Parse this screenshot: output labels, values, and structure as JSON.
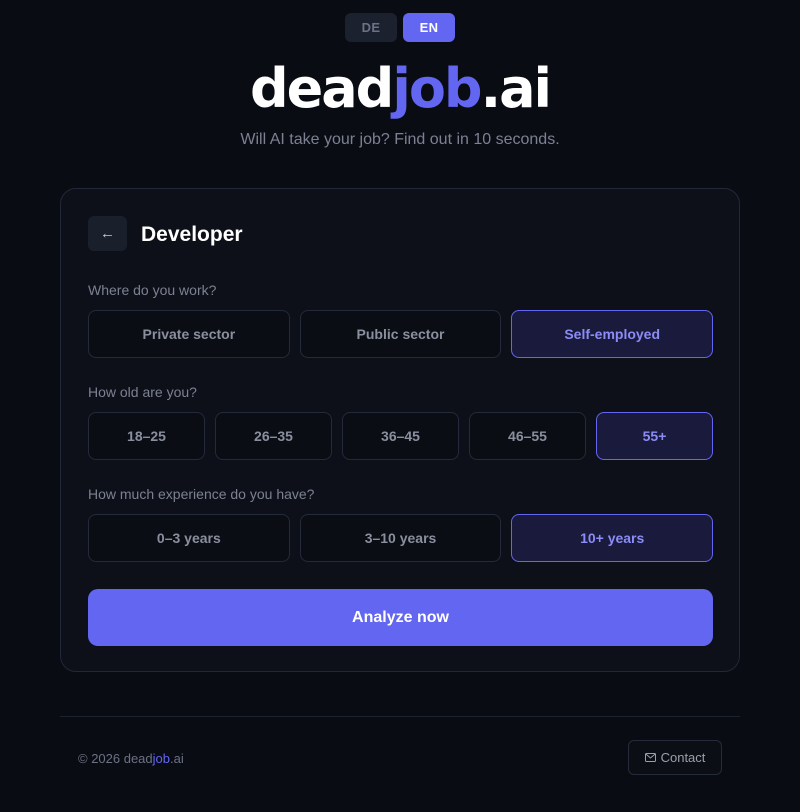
{
  "language": {
    "options": [
      {
        "label": "DE",
        "active": false
      },
      {
        "label": "EN",
        "active": true
      }
    ]
  },
  "brand": {
    "part1": "dead",
    "part2": "job",
    "part3": ".ai",
    "tagline": "Will AI take your job? Find out in 10 seconds.",
    "accent_color": "#6366f1"
  },
  "form": {
    "back_icon": "←",
    "job_title": "Developer",
    "sector": {
      "question": "Where do you work?",
      "options": [
        "Private sector",
        "Public sector",
        "Self-employed"
      ],
      "selected": "Self-employed"
    },
    "age": {
      "question": "How old are you?",
      "options": [
        "18–25",
        "26–35",
        "36–45",
        "46–55",
        "55+"
      ],
      "selected": "55+"
    },
    "experience": {
      "question": "How much experience do you have?",
      "options": [
        "0–3 years",
        "3–10 years",
        "10+ years"
      ],
      "selected": "10+ years"
    },
    "submit_label": "Analyze now"
  },
  "footer": {
    "copyright_prefix": "© 2026 dead",
    "copyright_accent": "job",
    "copyright_suffix": ".ai",
    "contact_icon": "mail-icon",
    "contact_label": "Contact"
  }
}
